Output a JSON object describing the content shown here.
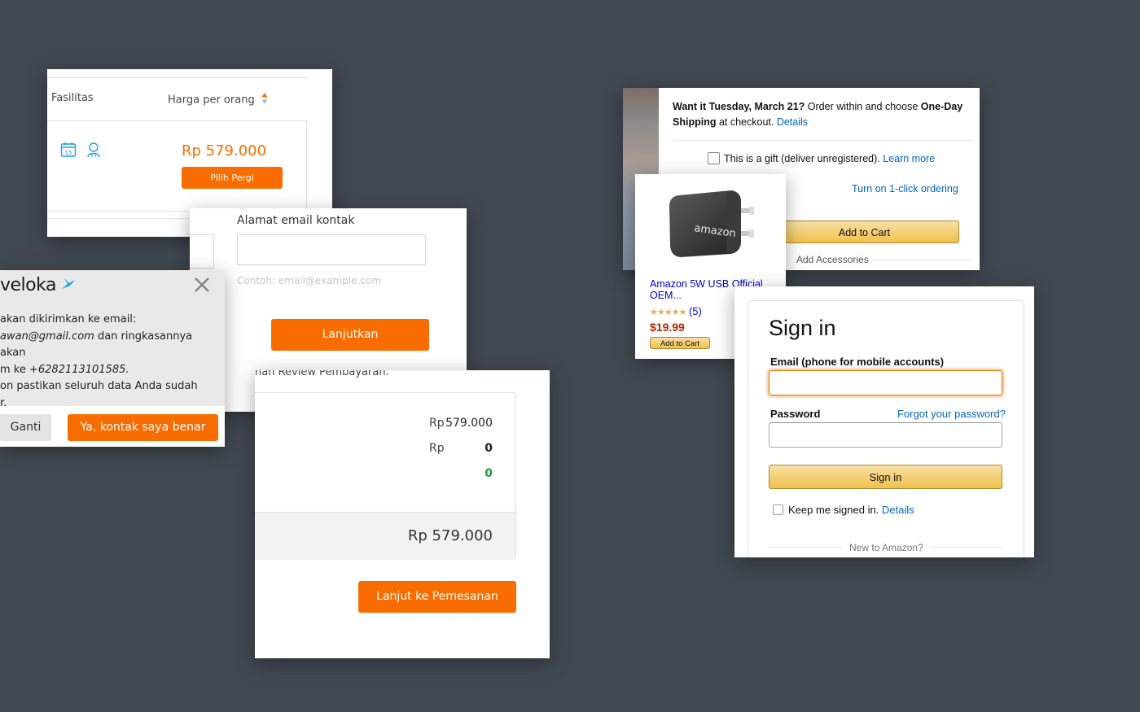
{
  "traveloka_results": {
    "col_fasilitas": "Fasilitas",
    "col_harga": "Harga per orang",
    "price": "Rp 579.000",
    "choose_button": "Pilih Pergi"
  },
  "traveloka_email_form": {
    "label": "Alamat email kontak",
    "input_value": "",
    "placeholder": "Contoh: email@example.com",
    "continue_button": "Lanjutkan"
  },
  "traveloka_confirm_dialog": {
    "logo_text": "veloka",
    "line1": "akan dikirimkan ke email:",
    "email": "awan@gmail.com",
    "line2_rest": " dan ringkasannya akan",
    "line3_prefix": "m ke ",
    "phone": "+6282113101585.",
    "line4": "on pastikan seluruh data Anda sudah",
    "line5": "r.",
    "change_button": "Ganti",
    "confirm_button": "Ya, kontak saya benar"
  },
  "traveloka_review": {
    "header_text": "nan Review Pembayaran.",
    "row1_currency": "Rp",
    "row1_value": "579.000",
    "row2_currency": "Rp",
    "row2_value": "0",
    "row3_value": "0",
    "total": "Rp 579.000",
    "continue_button": "Lanjut ke Pemesanan"
  },
  "amazon_buybox": {
    "delivery_bold1": "Want it Tuesday, March 21?",
    "delivery_text": " Order within and choose ",
    "delivery_bold2": "One-Day Shipping",
    "delivery_text2": " at checkout. ",
    "details_link": "Details",
    "gift_label": "This is a gift (deliver unregistered). ",
    "learn_more_link": "Learn more",
    "one_click_link": "Turn on 1-click ordering",
    "add_to_cart": "Add to Cart",
    "add_accessories": "Add Accessories"
  },
  "amazon_product": {
    "logo_text": "amazon",
    "title": "Amazon 5W USB Official OEM...",
    "stars": "★★★★★",
    "reviews": "(5)",
    "price": "$19.99",
    "add_to_cart": "Add to Cart"
  },
  "amazon_signin": {
    "title": "Sign in",
    "email_label": "Email (phone for mobile accounts)",
    "email_value": "",
    "password_label": "Password",
    "forgot_link": "Forgot your password?",
    "sign_in_button": "Sign in",
    "keep_signed": "Keep me signed in. ",
    "details_link": "Details",
    "new_to": "New to Amazon?"
  },
  "colors": {
    "background": "#414851",
    "traveloka_orange": "#f96d00",
    "traveloka_blue": "#1ba0e2",
    "amazon_link": "#0066c0",
    "amazon_button": "#f0c14b",
    "amazon_price": "#b12704"
  }
}
